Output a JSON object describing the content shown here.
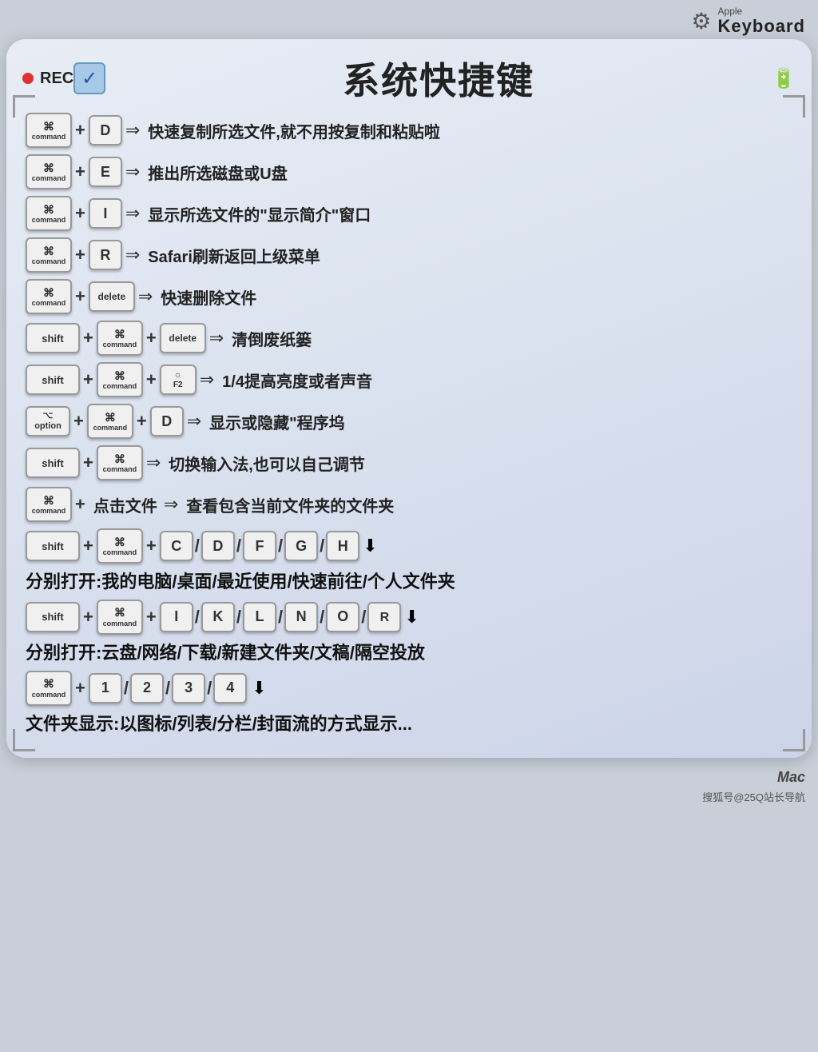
{
  "topbar": {
    "gear_symbol": "⚙",
    "apple_label": "Apple",
    "keyboard_label": "Keyboard"
  },
  "header": {
    "rec_label": "REC",
    "check_symbol": "✓",
    "title": "系统快捷键",
    "battery_symbol": "▓▓▓▒"
  },
  "keys": {
    "cmd_symbol": "⌘",
    "cmd_label": "command",
    "shift_label": "shift",
    "option_symbol": "⌥",
    "option_label": "option",
    "delete_label": "delete"
  },
  "shortcuts": [
    {
      "id": "cmd-d",
      "keys": [
        [
          "⌘",
          "command"
        ],
        "+",
        [
          "D"
        ],
        "⇒"
      ],
      "desc": "快速复制所选文件,就不用按复制和粘贴啦"
    },
    {
      "id": "cmd-e",
      "keys": [
        [
          "⌘",
          "command"
        ],
        "+",
        [
          "E"
        ],
        "⇒"
      ],
      "desc": "推出所选磁盘或U盘"
    },
    {
      "id": "cmd-i",
      "keys": [
        [
          "⌘",
          "command"
        ],
        "+",
        [
          "I"
        ],
        "⇒"
      ],
      "desc": "显示所选文件的\"显示简介\"窗口"
    },
    {
      "id": "cmd-r",
      "keys": [
        [
          "⌘",
          "command"
        ],
        "+",
        [
          "R"
        ],
        "⇒"
      ],
      "desc": "Safari刷新返回上级菜单"
    },
    {
      "id": "cmd-delete",
      "keys": [
        [
          "⌘",
          "command"
        ],
        "+",
        [
          "delete"
        ],
        "⇒"
      ],
      "desc": "快速删除文件"
    }
  ],
  "shortcut_shift_cmd_delete": "清倒废纸篓",
  "shortcut_shift_cmd_f2": "1/4提高亮度或者声音",
  "shortcut_option_cmd_d": "显示或隐藏\"程序坞",
  "shortcut_shift_cmd_input": "切换输入法,也可以自己调节",
  "shortcut_cmd_click": "点击文件",
  "shortcut_cmd_click_desc": "查看包含当前文件夹的文件夹",
  "shortcut_shift_cmd_folders": "分别打开:我的电脑/桌面/最近使用/快速前往/个人文件夹",
  "shortcut_shift_cmd_windows": "分别打开:云盘/网络/下载/新建文件夹/文稿/隔空投放",
  "shortcut_cmd_1234": "文件夹显示:以图标/列表/分栏/封面流的方式显示...",
  "bottom": {
    "mac_label": "Mac",
    "watermark": "搜狐号@25Q站长导航"
  }
}
